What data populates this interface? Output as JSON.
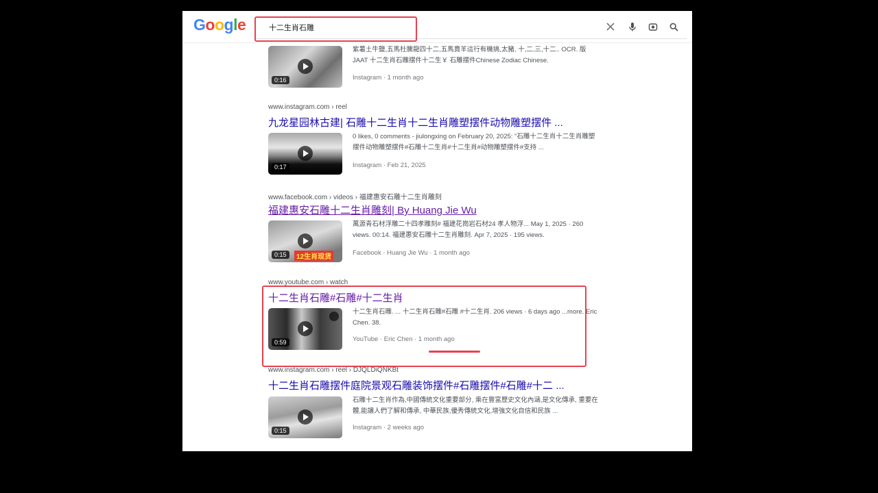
{
  "search": {
    "query": "十二生肖石雕",
    "logo": {
      "g1": "G",
      "o1": "o",
      "o2": "o",
      "g2": "g",
      "l": "l",
      "e": "e"
    }
  },
  "results": [
    {
      "snippet": "紫薯土牛鹽,五馬杜騰龍四十二,五馬賣羊這行有機搞,太豬, 十,二,三,十二.. OCR. 版JAAT 十二生肖石雕摆件十二生￥ 石雕摆件Chinese Zodiac Chinese.",
      "duration": "0:16",
      "source": "Instagram · 1 month ago"
    },
    {
      "url": "www.instagram.com › reel",
      "title": "九龙星园林古建| 石雕十二生肖十二生肖雕塑摆件动物雕塑摆件 ...",
      "snippet": "0 likes, 0 comments - jiulongxing on February 20, 2025: \"石雕十二生肖十二生肖雕塑摆件动物雕塑摆件#石雕十二生肖#十二生肖#动物雕塑摆件#支持 ...",
      "duration": "0:17",
      "source": "Instagram · Feb 21, 2025"
    },
    {
      "url": "www.facebook.com › videos › 福建惠安石雕十二生肖雕刻",
      "title": "福建惠安石雕十二生肖雕刻| By Huang Jie Wu",
      "snippet": "萬源青石材浮雕二十四孝雕刻# 福建花崗岩石材24 孝人物浮... May 1, 2025 · 260 views. 00:14. 福建惠安石雕十二生肖雕刻. Apr 7, 2025 · 195 views.",
      "duration": "0:15",
      "thumb_caption": "12生肖现货",
      "source": "Facebook · Huang Jie Wu · 1 month ago"
    },
    {
      "url": "www.youtube.com › watch",
      "title": "十二生肖石雕#石雕#十二生肖",
      "snippet": "十二生肖石雕. ... 十二生肖石雕#石雕 #十二生肖. 206 views · 6 days ago ...more. Eric Chen. 38.",
      "duration": "0:59",
      "source": "YouTube · Eric Chen · 1 month ago"
    },
    {
      "url": "www.instagram.com › reel › DJQLDiQNKBt",
      "title": "十二生肖石雕摆件庭院景观石雕装饰摆件#石雕摆件#石雕#十二 ...",
      "snippet": "石雕十二生肖作為,中國傳統文化重要部分, 乘在豐富歷史文化內涵,是文化傳承, 重要在體,能讓人們了解和傳承, 中華民族,優秀傳統文化,增強文化自信和民族 ...",
      "duration": "0:15",
      "source": "Instagram · 2 weeks ago"
    }
  ],
  "colors": {
    "link": "#1a0dab",
    "visited": "#681da8",
    "highlight": "#e8404f"
  }
}
